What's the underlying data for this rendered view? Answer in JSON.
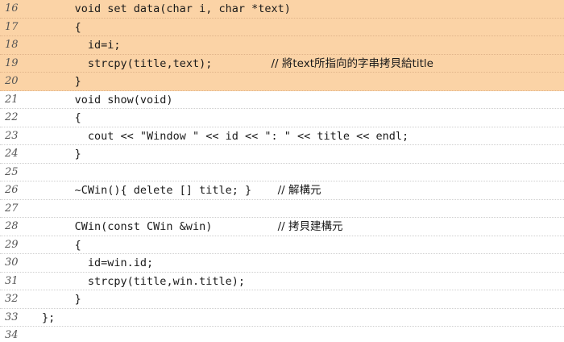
{
  "lines": [
    {
      "num": "16",
      "indent": "     ",
      "code": "void set data(char i, char *text)",
      "comment_pad": "",
      "comment": "",
      "highlight": true
    },
    {
      "num": "17",
      "indent": "     ",
      "code": "{",
      "comment_pad": "",
      "comment": "",
      "highlight": true
    },
    {
      "num": "18",
      "indent": "       ",
      "code": "id=i;",
      "comment_pad": "",
      "comment": "",
      "highlight": true
    },
    {
      "num": "19",
      "indent": "       ",
      "code": "strcpy(title,text);",
      "comment_pad": "         ",
      "comment": "// 將text所指向的字串拷貝給title",
      "highlight": true
    },
    {
      "num": "20",
      "indent": "     ",
      "code": "}",
      "comment_pad": "",
      "comment": "",
      "highlight": true
    },
    {
      "num": "21",
      "indent": "     ",
      "code": "void show(void)",
      "comment_pad": "",
      "comment": "",
      "highlight": false
    },
    {
      "num": "22",
      "indent": "     ",
      "code": "{",
      "comment_pad": "",
      "comment": "",
      "highlight": false
    },
    {
      "num": "23",
      "indent": "       ",
      "code": "cout << \"Window \" << id << \": \" << title << endl;",
      "comment_pad": "",
      "comment": "",
      "highlight": false
    },
    {
      "num": "24",
      "indent": "     ",
      "code": "}",
      "comment_pad": "",
      "comment": "",
      "highlight": false
    },
    {
      "num": "25",
      "indent": "",
      "code": "",
      "comment_pad": "",
      "comment": "",
      "highlight": false
    },
    {
      "num": "26",
      "indent": "     ",
      "code": "~CWin(){ delete [] title; }",
      "comment_pad": "    ",
      "comment": "// 解構元",
      "highlight": false
    },
    {
      "num": "27",
      "indent": "",
      "code": "",
      "comment_pad": "",
      "comment": "",
      "highlight": false
    },
    {
      "num": "28",
      "indent": "     ",
      "code": "CWin(const CWin &win)",
      "comment_pad": "          ",
      "comment": "// 拷貝建構元",
      "highlight": false
    },
    {
      "num": "29",
      "indent": "     ",
      "code": "{",
      "comment_pad": "",
      "comment": "",
      "highlight": false
    },
    {
      "num": "30",
      "indent": "       ",
      "code": "id=win.id;",
      "comment_pad": "",
      "comment": "",
      "highlight": false
    },
    {
      "num": "31",
      "indent": "       ",
      "code": "strcpy(title,win.title);",
      "comment_pad": "",
      "comment": "",
      "highlight": false
    },
    {
      "num": "32",
      "indent": "     ",
      "code": "}",
      "comment_pad": "",
      "comment": "",
      "highlight": false
    },
    {
      "num": "33",
      "indent": "",
      "code": "};",
      "comment_pad": "",
      "comment": "",
      "highlight": false
    },
    {
      "num": "34",
      "indent": "",
      "code": "",
      "comment_pad": "",
      "comment": "",
      "highlight": false
    }
  ],
  "colors": {
    "highlight_bg": "#fbd3a6",
    "line_number": "#555555",
    "text": "#1a1a1a"
  }
}
